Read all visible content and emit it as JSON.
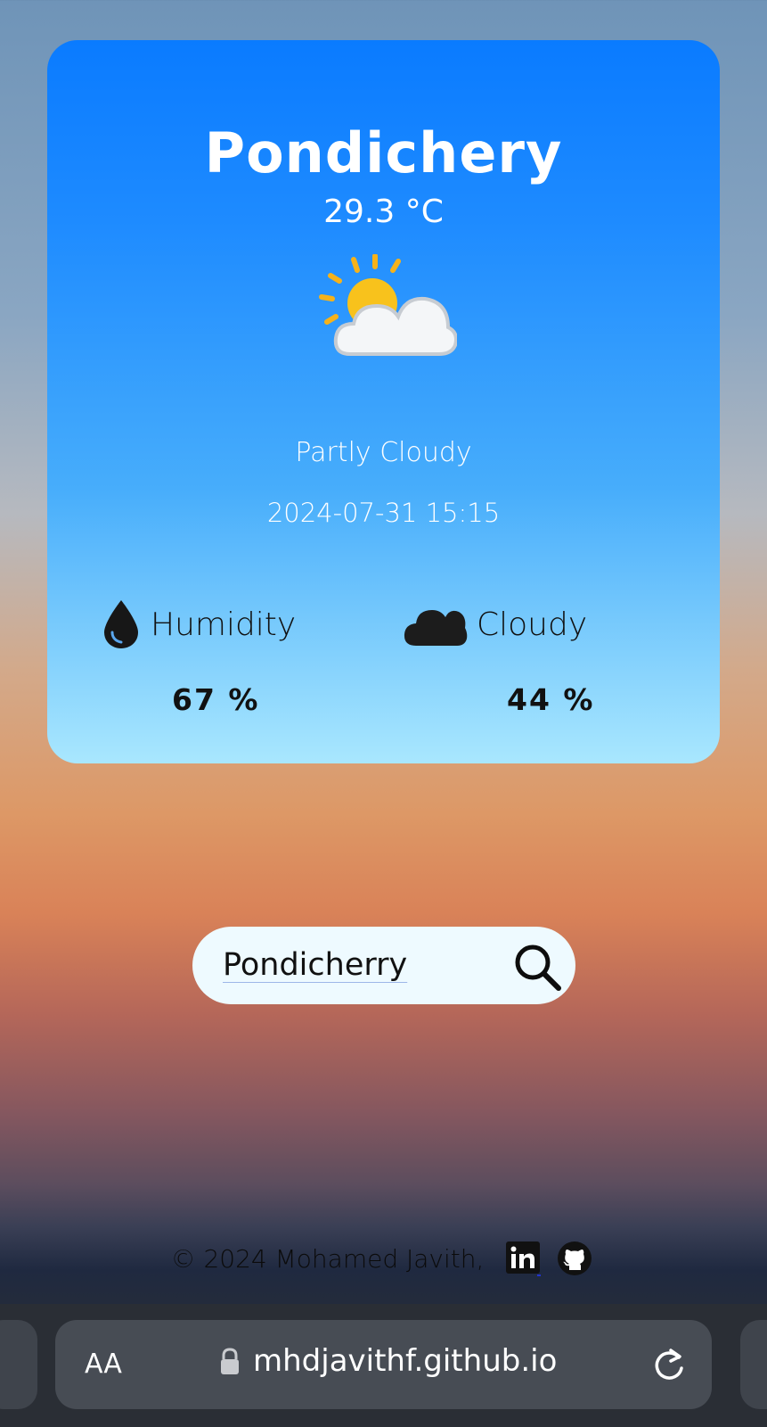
{
  "weather": {
    "city": "Pondichery",
    "temperature": "29.3 °C",
    "condition": "Partly Cloudy",
    "datetime": "2024-07-31 15:15",
    "icon": "partly-cloudy-icon",
    "humidity": {
      "label": "Humidity",
      "value": "67 %",
      "icon": "droplet-icon"
    },
    "clouds": {
      "label": "Cloudy",
      "value": "44 %",
      "icon": "cloud-icon"
    }
  },
  "search": {
    "value": "Pondicherry",
    "icon": "search-icon"
  },
  "footer": {
    "copyright": "© 2024 Mohamed Javith,",
    "links": [
      {
        "icon": "linkedin-icon"
      },
      {
        "icon": "github-icon"
      }
    ]
  },
  "browser": {
    "text_size_label": "AA",
    "url": "mhdjavithf.github.io",
    "lock_icon": "lock-icon",
    "reload_icon": "reload-icon"
  },
  "colors": {
    "card_top": "#0a7bff",
    "card_bottom": "#a9e7fe",
    "search_bg": "#eefaff"
  }
}
